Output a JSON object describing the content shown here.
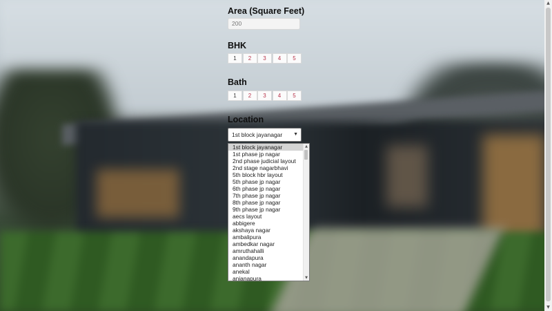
{
  "form": {
    "area": {
      "label": "Area (Square Feet)",
      "placeholder": "200"
    },
    "bhk": {
      "label": "BHK",
      "options": [
        "1",
        "2",
        "3",
        "4",
        "5"
      ]
    },
    "bath": {
      "label": "Bath",
      "options": [
        "1",
        "2",
        "3",
        "4",
        "5"
      ]
    },
    "location": {
      "label": "Location",
      "selected": "1st block jayanagar",
      "dropdown_icon": "chevron-down-icon",
      "options": [
        "1st block jayanagar",
        "1st phase jp nagar",
        "2nd phase judicial layout",
        "2nd stage nagarbhavi",
        "5th block hbr layout",
        "5th phase jp nagar",
        "6th phase jp nagar",
        "7th phase jp nagar",
        "8th phase jp nagar",
        "9th phase jp nagar",
        "aecs layout",
        "abbigere",
        "akshaya nagar",
        "ambalipura",
        "ambedkar nagar",
        "amruthahalli",
        "anandapura",
        "ananth nagar",
        "anekal",
        "anjanapura"
      ]
    }
  },
  "colors": {
    "option_text": "#b8324a",
    "selected_option_bg": "#d4d4d4"
  }
}
